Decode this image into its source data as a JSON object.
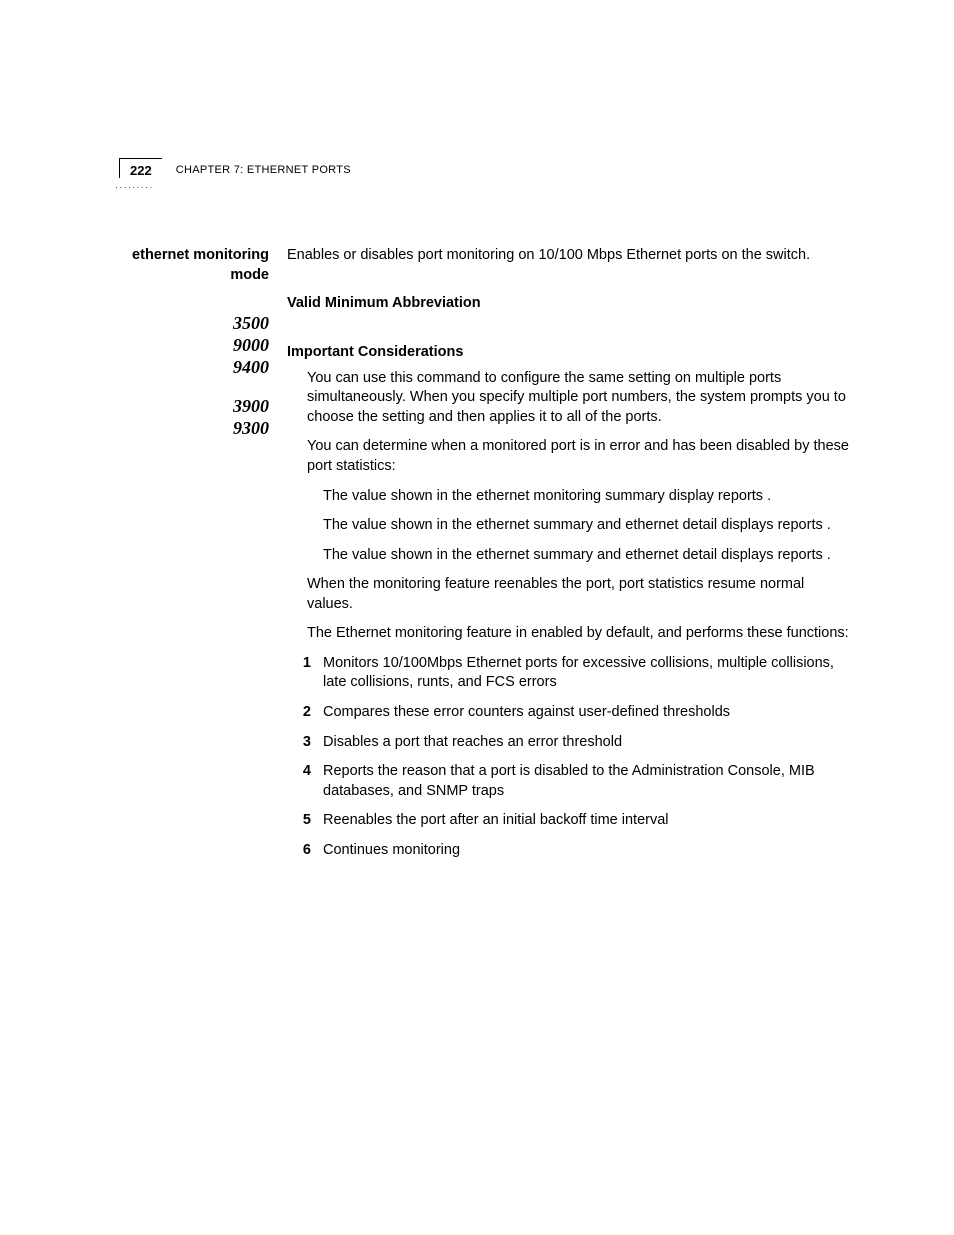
{
  "header": {
    "page_number": "222",
    "chapter_label": "CHAPTER 7: ETHERNET PORTS"
  },
  "sidebar": {
    "title": "ethernet monitoring mode",
    "product_group_1": [
      "3500",
      "9000",
      "9400"
    ],
    "product_group_2": [
      "3900",
      "9300"
    ]
  },
  "main": {
    "intro": "Enables or disables port monitoring on 10/100 Mbps Ethernet ports on the switch.",
    "valid_min_abbrev_head": "Valid Minimum Abbreviation",
    "important_head": "Important Considerations",
    "bullets": [
      "You can use this command to configure the same setting on multiple ports simultaneously. When you specify multiple port numbers, the system prompts you to choose the setting and then applies it to all of the ports.",
      "You can determine when a monitored port is in error and has been disabled by these port statistics:"
    ],
    "sub_bullets": [
      "The            value  shown in the ethernet monitoring summary display reports                .",
      "The                   value shown in the ethernet summary and ethernet detail displays reports                       .",
      "The                   value shown in the ethernet summary and ethernet detail  displays reports                 ."
    ],
    "para_after_sub": "When the monitoring feature reenables the port, port statistics resume normal values.",
    "para_enabled": "The Ethernet monitoring feature in enabled by default, and performs these functions:",
    "numbered": [
      "Monitors 10/100Mbps Ethernet ports for excessive collisions, multiple collisions, late collisions, runts, and FCS errors",
      "Compares these error counters against user-defined thresholds",
      "Disables a port that reaches an error threshold",
      "Reports the reason that a port is disabled to the Administration Console, MIB databases, and SNMP traps",
      "Reenables the port after an initial backoff time interval",
      "Continues monitoring"
    ]
  }
}
